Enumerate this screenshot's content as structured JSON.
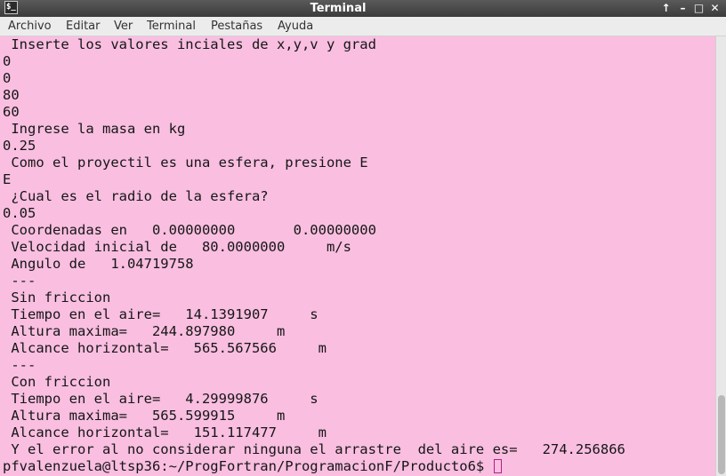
{
  "window": {
    "title": "Terminal",
    "app_icon_glyph": "$_",
    "controls": {
      "up": "↑",
      "minimize": "–",
      "maximize": "□",
      "close": "✕"
    }
  },
  "menubar": {
    "items": [
      "Archivo",
      "Editar",
      "Ver",
      "Terminal",
      "Pestañas",
      "Ayuda"
    ]
  },
  "terminal": {
    "lines": [
      " Inserte los valores inciales de x,y,v y grad",
      "0",
      "0",
      "80",
      "60",
      " Ingrese la masa en kg",
      "0.25",
      " Como el proyectil es una esfera, presione E",
      "E",
      " ¿Cual es el radio de la esfera?",
      "0.05",
      " Coordenadas en   0.00000000       0.00000000",
      " Velocidad inicial de   80.0000000     m/s",
      " Angulo de   1.04719758",
      " ---",
      " Sin friccion",
      " Tiempo en el aire=   14.1391907     s",
      " Altura maxima=   244.897980     m",
      " Alcance horizontal=   565.567566     m",
      " ---",
      " Con friccion",
      " Tiempo en el aire=   4.29999876     s",
      " Altura maxima=   565.599915     m",
      " Alcance horizontal=   151.117477     m",
      " Y el error al no considerar ninguna el arrastre  del aire es=   274.256866"
    ],
    "prompt": "pfvalenzuela@ltsp36:~/ProgFortran/ProgramacionF/Producto6$ "
  },
  "colors": {
    "terminal_background": "#f9bee0",
    "terminal_text": "#161616",
    "cursor": "#b0228a"
  },
  "icons": [
    "terminal-app-icon",
    "up-arrow-icon",
    "minimize-icon",
    "maximize-icon",
    "close-icon"
  ]
}
